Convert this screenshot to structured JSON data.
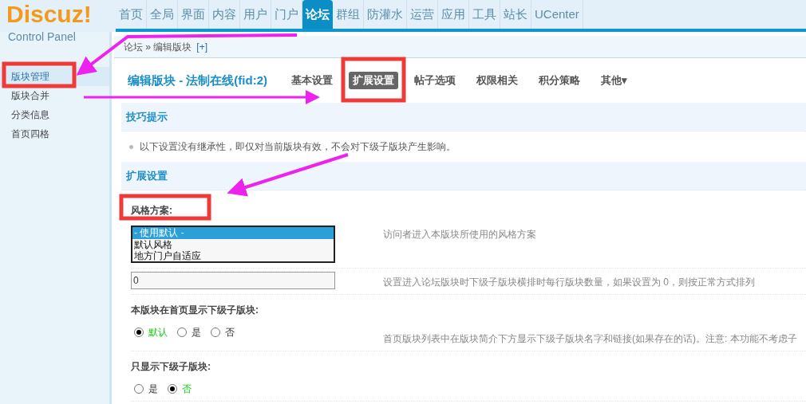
{
  "logo": {
    "title": "Discuz!",
    "subtitle": "Control Panel"
  },
  "nav": [
    {
      "label": "首页",
      "selected": false
    },
    {
      "label": "全局",
      "selected": false
    },
    {
      "label": "界面",
      "selected": false
    },
    {
      "label": "内容",
      "selected": false
    },
    {
      "label": "用户",
      "selected": false
    },
    {
      "label": "门户",
      "selected": false
    },
    {
      "label": "论坛",
      "selected": true
    },
    {
      "label": "群组",
      "selected": false
    },
    {
      "label": "防灌水",
      "selected": false
    },
    {
      "label": "运营",
      "selected": false
    },
    {
      "label": "应用",
      "selected": false
    },
    {
      "label": "工具",
      "selected": false
    },
    {
      "label": "站长",
      "selected": false
    },
    {
      "label": "UCenter",
      "selected": false
    }
  ],
  "sidebar": {
    "items": [
      {
        "label": "版块管理",
        "selected": true
      },
      {
        "label": "版块合并",
        "selected": false
      },
      {
        "label": "分类信息",
        "selected": false
      },
      {
        "label": "首页四格",
        "selected": false
      }
    ]
  },
  "breadcrumb": {
    "path": "论坛 » 编辑版块",
    "add": "[+]"
  },
  "page_title": "编辑版块 - 法制在线(fid:2)",
  "tabs": [
    {
      "label": "基本设置",
      "selected": false
    },
    {
      "label": "扩展设置",
      "selected": true
    },
    {
      "label": "帖子选项",
      "selected": false
    },
    {
      "label": "权限相关",
      "selected": false
    },
    {
      "label": "积分策略",
      "selected": false
    },
    {
      "label": "其他▾",
      "selected": false
    }
  ],
  "tips": {
    "title": "技巧提示",
    "items": [
      "以下设置没有继承性，即仅对当前版块有效，不会对下级子版块产生影响。"
    ]
  },
  "section_title": "扩展设置",
  "settings": [
    {
      "kind": "list",
      "label": "风格方案:",
      "options": [
        {
          "label": "- 使用默认 -",
          "selected": true
        },
        {
          "label": "默认风格",
          "selected": false
        },
        {
          "label": "地方门户自适应",
          "selected": false
        }
      ],
      "hint": "访问者进入本版块所使用的风格方案"
    },
    {
      "kind": "text",
      "value": "0",
      "hint": "设置进入论坛版块时下级子版块横排时每行版块数量，如果设置为 0，则按正常方式排列"
    },
    {
      "kind": "radio",
      "label": "本版块在首页显示下级子版块:",
      "options": [
        {
          "label": "默认",
          "selected": true
        },
        {
          "label": "是",
          "selected": false
        },
        {
          "label": "否",
          "selected": false
        }
      ],
      "hint": "首页版块列表中在版块简介下方显示下级子版块名字和链接(如果存在的话)。注意: 本功能不考虑子"
    },
    {
      "kind": "radio",
      "label": "只显示下级子版块:",
      "options": [
        {
          "label": "是",
          "selected": false
        },
        {
          "label": "否",
          "selected": true
        }
      ]
    }
  ]
}
